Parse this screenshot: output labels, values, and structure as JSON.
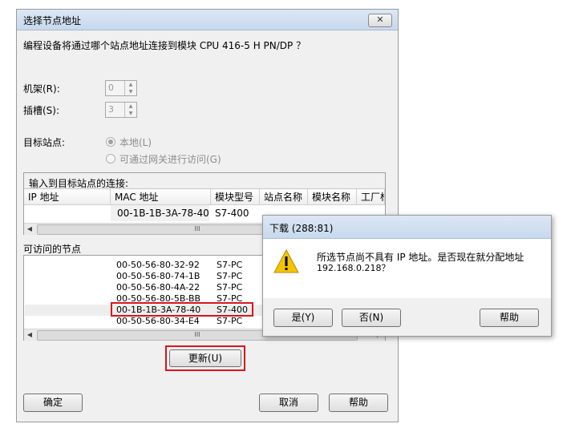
{
  "main_dialog": {
    "title": "选择节点地址",
    "close_label": "✕",
    "question": "编程设备将通过哪个站点地址连接到模块 CPU 416-5 H PN/DP ？",
    "rack_label": "机架(R):",
    "rack_value": "0",
    "slot_label": "插槽(S):",
    "slot_value": "3",
    "target_label": "目标站点:",
    "radio_local": "本地(L)",
    "radio_gateway": "可通过网关进行访问(G)",
    "connection_group": "输入到目标站点的连接:",
    "connection_columns": [
      "IP 地址",
      "MAC 地址",
      "模块型号",
      "站点名称",
      "模块名称",
      "工厂标"
    ],
    "connection_row": {
      "ip": "",
      "mac": "00-1B-1B-3A-78-40",
      "type": "S7-400"
    },
    "accessible_label": "可访问的节点",
    "nodes": [
      {
        "mac": "00-50-56-80-32-92",
        "type": "S7-PC"
      },
      {
        "mac": "00-50-56-80-74-1B",
        "type": "S7-PC"
      },
      {
        "mac": "00-50-56-80-4A-22",
        "type": "S7-PC"
      },
      {
        "mac": "00-50-56-80-5B-BB",
        "type": "S7-PC"
      },
      {
        "mac": "00-1B-1B-3A-78-40",
        "type": "S7-400"
      },
      {
        "mac": "00-50-56-80-34-E4",
        "type": "S7-PC"
      }
    ],
    "scroll_thumb": "III",
    "refresh_button": "更新(U)",
    "ok_button": "确定",
    "cancel_button": "取消",
    "help_button": "帮助"
  },
  "popup": {
    "title": "下载 (288:81)",
    "message_line1": "所选节点尚不具有 IP 地址。是否现在就分配地址",
    "message_line2": "192.168.0.218？",
    "yes_button": "是(Y)",
    "no_button": "否(N)",
    "help_button": "帮助"
  },
  "colors": {
    "highlight": "#d9141b",
    "warning": "#f2c500"
  }
}
